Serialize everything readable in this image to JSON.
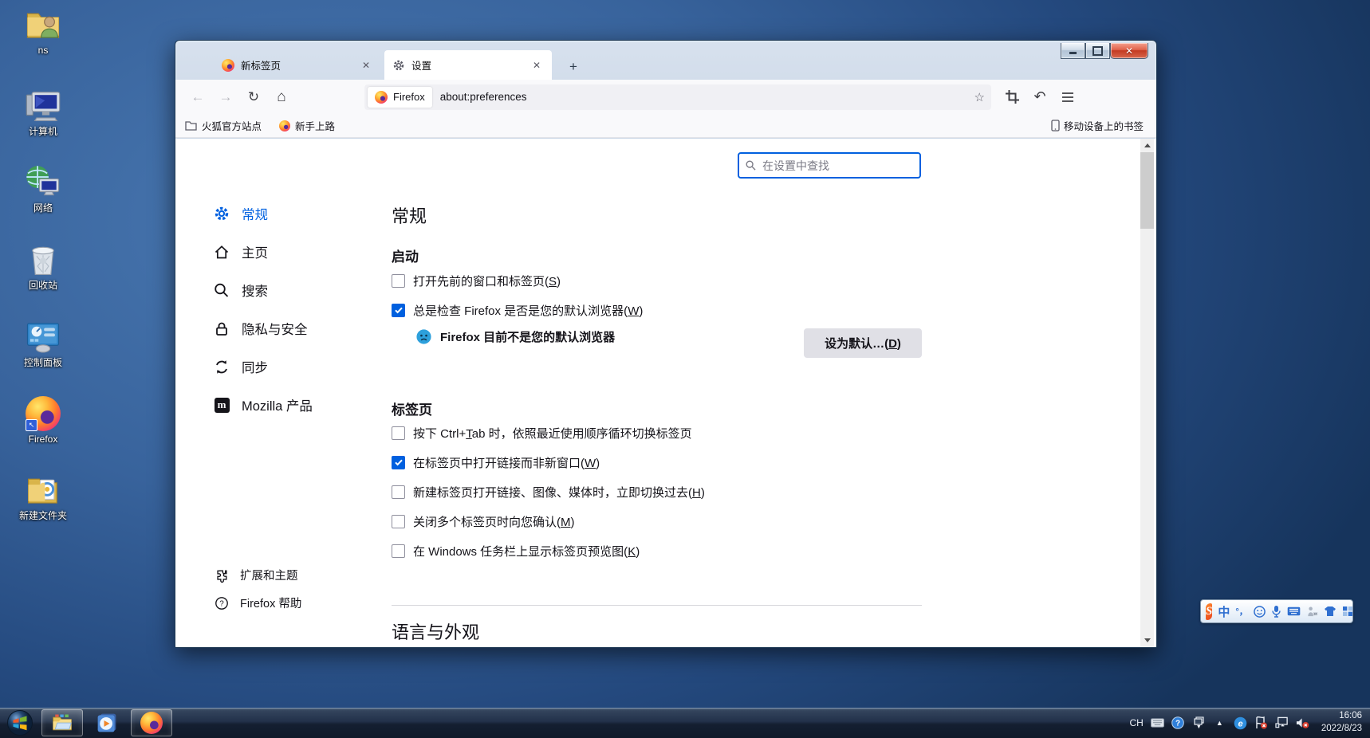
{
  "desktop": {
    "icons": [
      {
        "label": "ns",
        "icon": "user-folder-icon"
      },
      {
        "label": "计算机",
        "icon": "computer-icon"
      },
      {
        "label": "网络",
        "icon": "network-icon"
      },
      {
        "label": "回收站",
        "icon": "recycle-bin-icon"
      },
      {
        "label": "控制面板",
        "icon": "control-panel-icon"
      },
      {
        "label": "Firefox",
        "icon": "firefox-icon"
      },
      {
        "label": "新建文件夹",
        "icon": "new-folder-icon"
      }
    ]
  },
  "browser": {
    "tabs": [
      {
        "title": "新标签页",
        "icon": "firefox-icon",
        "active": false,
        "close": "✕"
      },
      {
        "title": "设置",
        "icon": "gear-icon",
        "active": true,
        "close": "✕"
      }
    ],
    "newtab_button": "+",
    "nav": {
      "back": "←",
      "forward": "→",
      "reload": "↻",
      "home": "⌂",
      "site_label": "Firefox",
      "url": "about:preferences",
      "star": "☆",
      "right_icons": [
        "screenshot-crop-icon",
        "undo-icon",
        "menu-icon"
      ]
    },
    "bookmarks": {
      "items": [
        {
          "label": "火狐官方站点",
          "icon": "folder-icon"
        },
        {
          "label": "新手上路",
          "icon": "globe-icon"
        }
      ],
      "mobile_label": "移动设备上的书签",
      "mobile_icon": "phone-icon"
    },
    "window_controls": {
      "minimize": "minimize",
      "maximize": "maximize",
      "close": "✕"
    }
  },
  "prefs": {
    "search_placeholder": "在设置中查找",
    "sidebar": [
      {
        "label": "常规",
        "icon": "gear-icon",
        "active": true
      },
      {
        "label": "主页",
        "icon": "home-icon",
        "active": false
      },
      {
        "label": "搜索",
        "icon": "search-icon",
        "active": false
      },
      {
        "label": "隐私与安全",
        "icon": "lock-icon",
        "active": false
      },
      {
        "label": "同步",
        "icon": "sync-icon",
        "active": false
      },
      {
        "label": "Mozilla 产品",
        "icon": "mozilla-icon",
        "active": false
      }
    ],
    "sidebar_bottom": [
      {
        "label": "扩展和主题",
        "icon": "puzzle-icon"
      },
      {
        "label": "Firefox 帮助",
        "icon": "help-icon"
      }
    ],
    "title": "常规",
    "startup": {
      "heading": "启动",
      "items": [
        {
          "checked": false,
          "pre": "打开先前的窗口和标签页(",
          "key": "S",
          "post": ")"
        },
        {
          "checked": true,
          "pre": "总是检查 Firefox 是否是您的默认浏览器(",
          "key": "W",
          "post": ")"
        }
      ],
      "notice": "Firefox 目前不是您的默认浏览器",
      "notice_icon": "sad-face-icon",
      "set_default": {
        "pre": "设为默认…(",
        "key": "D",
        "post": ")"
      }
    },
    "tabs_section": {
      "heading": "标签页",
      "items": [
        {
          "checked": false,
          "pre": "按下 Ctrl+",
          "key": "T",
          "post": "ab 时，依照最近使用顺序循环切换标签页"
        },
        {
          "checked": true,
          "pre": "在标签页中打开链接而非新窗口(",
          "key": "W",
          "post": ")"
        },
        {
          "checked": false,
          "pre": "新建标签页打开链接、图像、媒体时，立即切换过去(",
          "key": "H",
          "post": ")"
        },
        {
          "checked": false,
          "pre": "关闭多个标签页时向您确认(",
          "key": "M",
          "post": ")"
        },
        {
          "checked": false,
          "pre": "在 Windows 任务栏上显示标签页预览图(",
          "key": "K",
          "post": ")"
        }
      ]
    },
    "next_section": "语言与外观",
    "accent_color": "#0061e0"
  },
  "taskbar": {
    "start": "start-button",
    "apps": [
      {
        "name": "explorer",
        "icon": "explorer-icon",
        "running": true
      },
      {
        "name": "media-player",
        "icon": "media-player-icon",
        "running": false
      },
      {
        "name": "firefox",
        "icon": "firefox-icon",
        "running": true
      }
    ],
    "tray": {
      "lang": "CH",
      "icons": [
        "keyboard-icon",
        "help-icon",
        "window-switcher-icon",
        "show-hidden-icon",
        "ie-icon",
        "action-center-icon",
        "network-icon",
        "volume-muted-icon"
      ],
      "time": "16:06",
      "date": "2022/8/23"
    }
  },
  "ime": {
    "logo": "S",
    "mode": "中",
    "punct": "°，",
    "icons": [
      "smiley-icon",
      "mic-icon",
      "keyboard-icon",
      "handwriting-icon",
      "skin-icon",
      "toolbox-icon"
    ]
  }
}
